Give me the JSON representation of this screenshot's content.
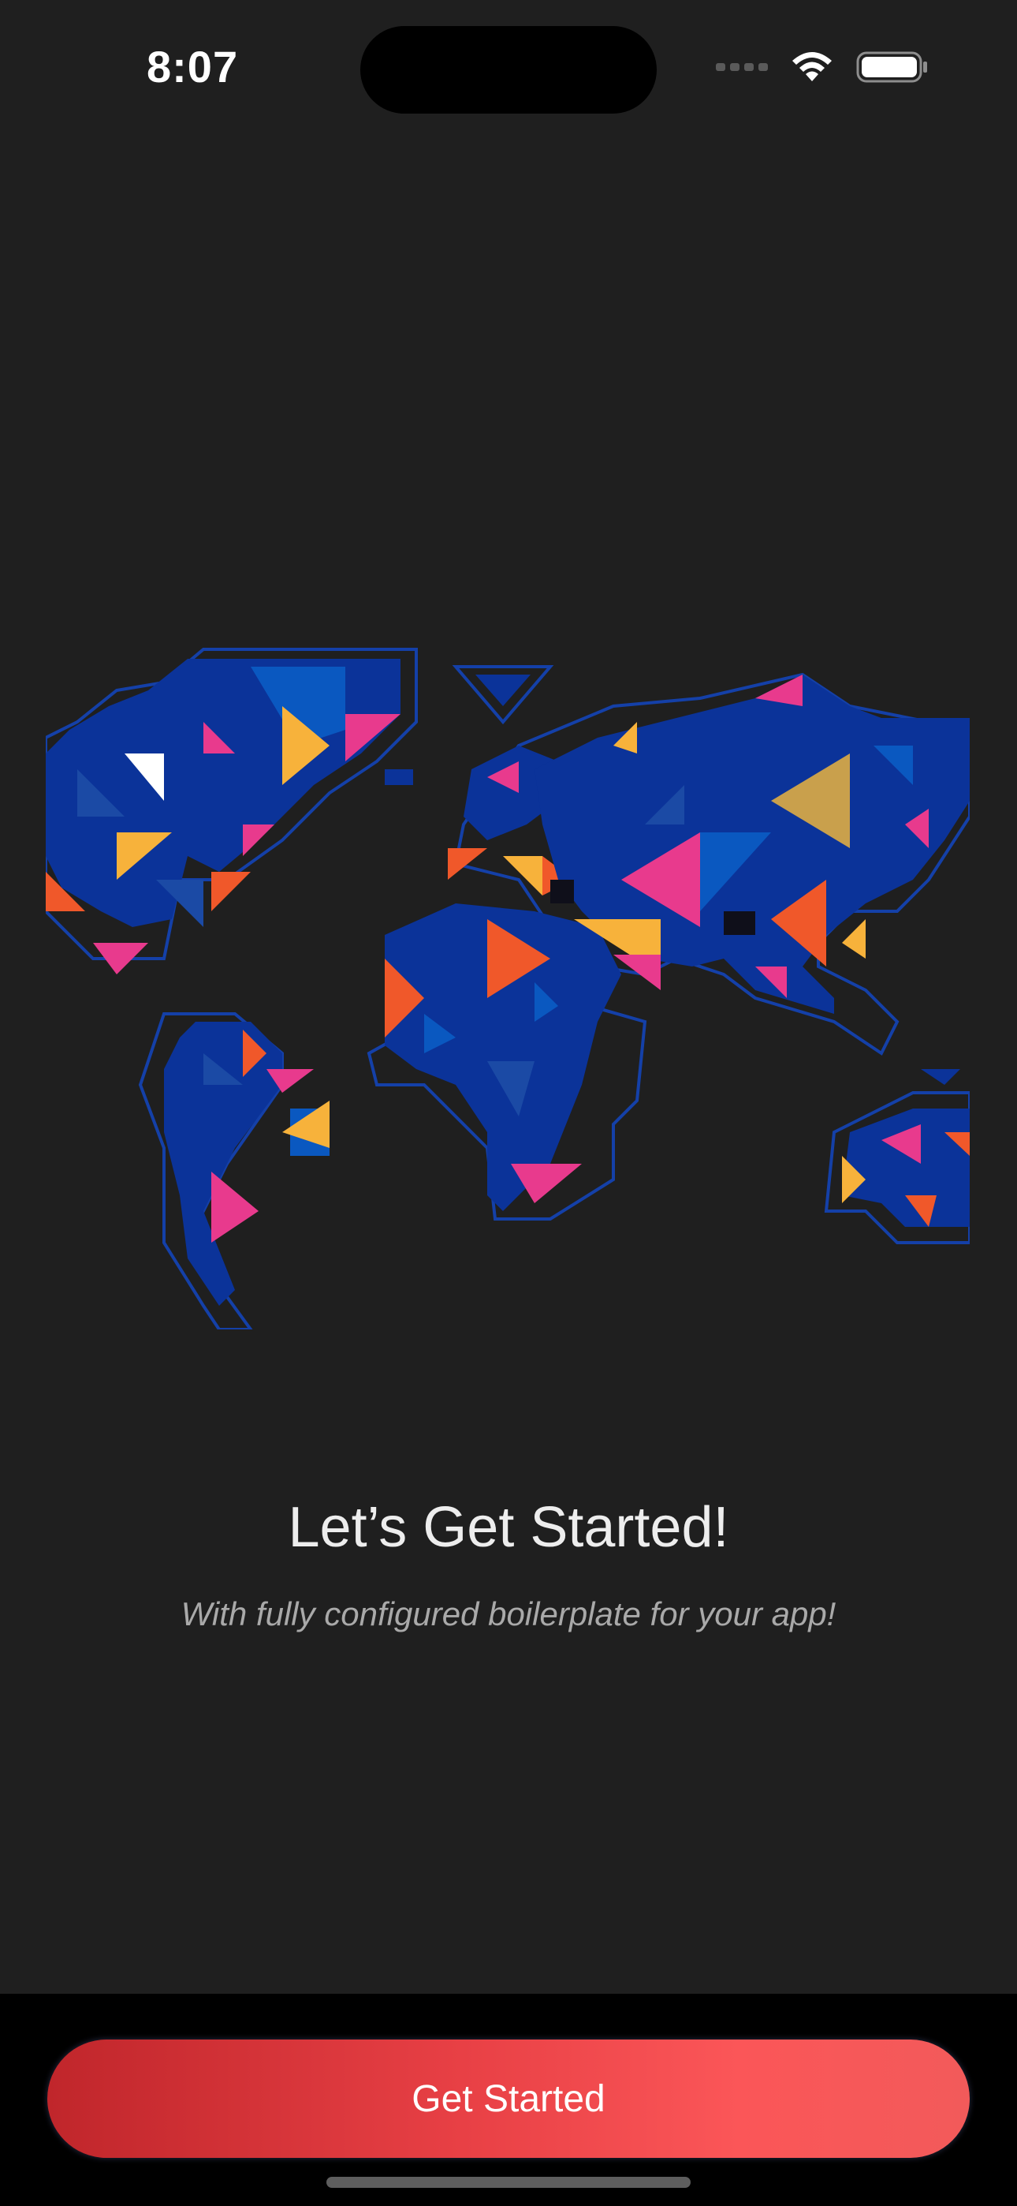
{
  "status_bar": {
    "time": "8:07",
    "icons": [
      "cellular-signal-icon",
      "wifi-icon",
      "battery-icon"
    ]
  },
  "illustration": {
    "icon": "world-map-icon",
    "colors": {
      "land": "#0b3399",
      "land_light": "#0a58c0",
      "outline": "#1440a8",
      "pink": "#e83a8d",
      "orange": "#f0582a",
      "yellow": "#f7b23b",
      "white": "#ffffff"
    }
  },
  "onboarding": {
    "title": "Let’s Get Started!",
    "subtitle": "With fully configured boilerplate for your app!"
  },
  "cta": {
    "label": "Get Started"
  },
  "colors": {
    "background": "#1f1f1f",
    "bottom_bar": "#000000",
    "accent_start": "#c0262b",
    "accent_end": "#fb5658"
  }
}
